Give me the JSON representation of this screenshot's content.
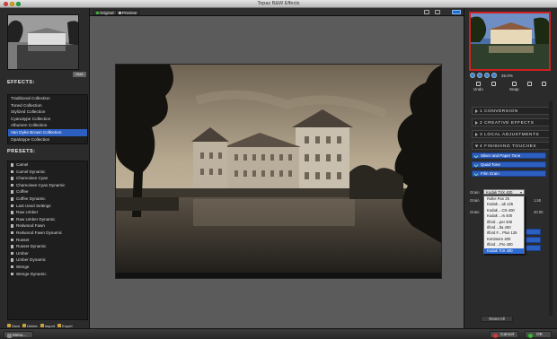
{
  "window": {
    "title": "Topaz B&W Effects"
  },
  "left_panel": {
    "hide_label": "Hide",
    "effects_title": "EFFECTS:",
    "effects": [
      {
        "label": "Traditional Collection",
        "selected": false
      },
      {
        "label": "Toned Collection",
        "selected": false
      },
      {
        "label": "Stylized Collection",
        "selected": false
      },
      {
        "label": "Cyanotype Collection",
        "selected": false
      },
      {
        "label": "Albumen Collection",
        "selected": false
      },
      {
        "label": "Van Dyke Brown Collection",
        "selected": true
      },
      {
        "label": "Opalotype Collection",
        "selected": false
      }
    ],
    "presets_title": "PRESETS:",
    "presets": [
      "Camel",
      "Camel Dynamic",
      "Chamoisee Cyan",
      "Chamoisee Cyan Dynamic",
      "Coffee",
      "Coffee Dynamic",
      "Last Used Settings",
      "Raw Umber",
      "Raw Umber Dynamic",
      "Redwood Fawn",
      "Redwood Fawn Dynamic",
      "Russet",
      "Russet Dynamic",
      "Umber",
      "Umber Dynamic",
      "Wenge",
      "Wenge Dynamic"
    ],
    "preset_buttons": [
      "Save",
      "Delete",
      "Import",
      "Export"
    ]
  },
  "center": {
    "tab_original": "Original",
    "tab_preview": "Preview"
  },
  "right_panel": {
    "zoom_value": "25.0%",
    "undo_label": "Undo",
    "snap_label": "Snap",
    "sections": [
      {
        "num": "1",
        "label": "CONVERSION"
      },
      {
        "num": "2",
        "label": "CREATIVE EFFECTS"
      },
      {
        "num": "3",
        "label": "LOCAL ADJUSTMENTS"
      },
      {
        "num": "4",
        "label": "FINISHING TOUCHES"
      }
    ],
    "finishing_rows": [
      "Silver and Paper Tone",
      "Quad Tone",
      "Film Grain"
    ],
    "grain_label": "Grain",
    "grain_selected": "Kodak TriX 400",
    "grain_options": [
      "Kodak TriX 400",
      "Rollei Pan 25",
      "Kodak ...ak 125",
      "Kodak ...CN 400",
      "Kodak ...rs 400",
      "Ilford ...per 400",
      "Ilford ...lta 400",
      "Ilford F... Plus 125",
      "Kentmere 400",
      "Ilford ...Pro 400",
      "Kodak TriX 400"
    ],
    "values": [
      "1.50",
      "40.00"
    ],
    "reset_label": "Reset All"
  },
  "bottom": {
    "menu_label": "Menu...",
    "cancel_label": "Cancel",
    "ok_label": "OK"
  },
  "colors": {
    "accent": "#2d5fc0",
    "nav_border": "#d02020"
  }
}
